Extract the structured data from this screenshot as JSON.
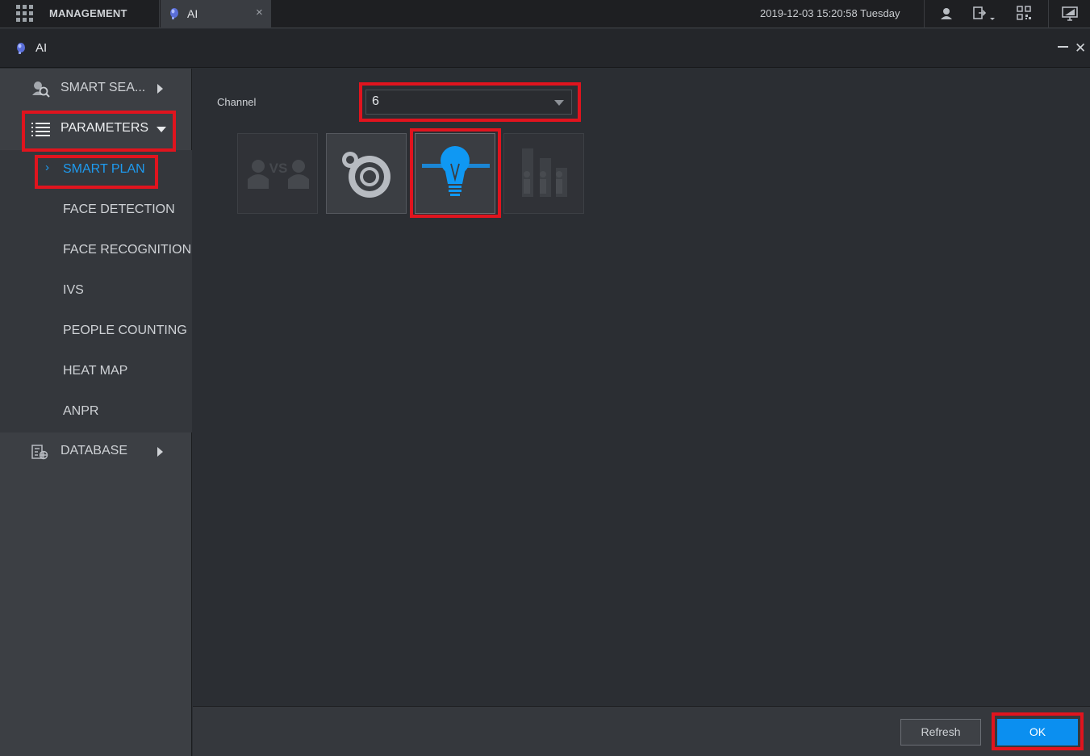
{
  "topbar": {
    "management_label": "MANAGEMENT",
    "tab_label": "AI",
    "tab_close": "×",
    "datetime": "2019-12-03 15:20:58 Tuesday",
    "icons": [
      "grid-icon",
      "user-icon",
      "logout-icon",
      "qr-code-icon",
      "display-icon"
    ]
  },
  "window": {
    "title": "AI",
    "close_glyph": "✕"
  },
  "sidebar": {
    "smart_search": "SMART SEA...",
    "parameters": "PARAMETERS",
    "sub_items": [
      {
        "label": "SMART PLAN",
        "active": true
      },
      {
        "label": "FACE DETECTION",
        "active": false
      },
      {
        "label": "FACE RECOGNITION",
        "active": false
      },
      {
        "label": "IVS",
        "active": false
      },
      {
        "label": "PEOPLE COUNTING",
        "active": false
      },
      {
        "label": "HEAT MAP",
        "active": false
      },
      {
        "label": "ANPR",
        "active": false
      }
    ],
    "database": "DATABASE"
  },
  "content": {
    "channel_label": "Channel",
    "channel_value": "6",
    "plans": [
      {
        "name": "face-vs-icon",
        "text": "VS",
        "state": "disabled"
      },
      {
        "name": "camera-lens-icon",
        "state": "normal"
      },
      {
        "name": "lightbulb-icon",
        "state": "selected"
      },
      {
        "name": "people-counting-icon",
        "state": "disabled"
      }
    ]
  },
  "footer": {
    "refresh_label": "Refresh",
    "ok_label": "OK"
  },
  "colors": {
    "accent": "#1e9bf0",
    "highlight_red": "#e0141e",
    "ok_button": "#0b8ff0"
  }
}
